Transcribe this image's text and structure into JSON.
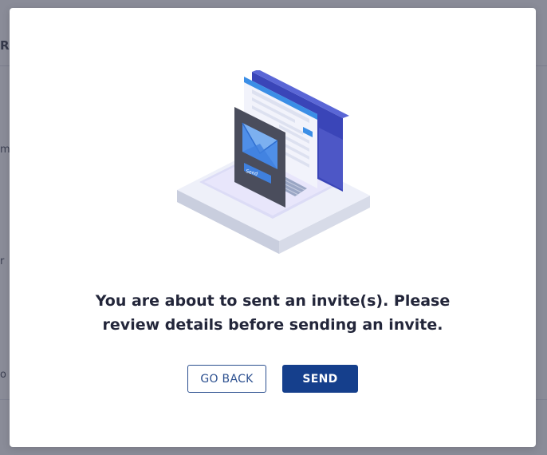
{
  "background": {
    "fragments": [
      "R",
      "m",
      "r",
      "o"
    ]
  },
  "modal": {
    "illustration_icon": "envelope-send-laptop-illustration",
    "illustration_button_label": "Send",
    "message_line1": "You are about to sent an invite(s). Please",
    "message_line2": "review details before sending an invite.",
    "back_button_label": "GO BACK",
    "send_button_label": "SEND"
  },
  "colors": {
    "primary": "#153f8c",
    "outline": "#2b4f8f",
    "text": "#23263a",
    "overlay": "rgba(60,64,84,0.60)"
  }
}
